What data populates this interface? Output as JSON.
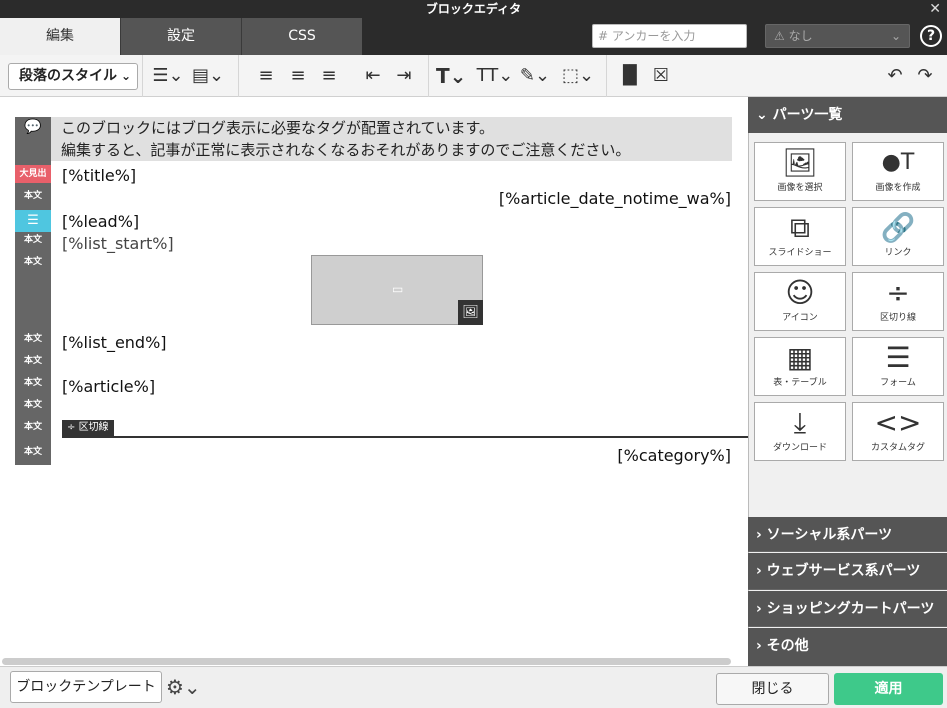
{
  "window": {
    "title": "ブロックエディタ"
  },
  "tabs": [
    {
      "label": "編集"
    },
    {
      "label": "設定"
    },
    {
      "label": "CSS"
    }
  ],
  "anchor": {
    "placeholder": "アンカーを入力",
    "hash": "#"
  },
  "class_select": {
    "value": "なし"
  },
  "toolbar": {
    "paragraph_style": "段落のスタイル"
  },
  "notice": {
    "line1": "このブロックにはブログ表示に必要なタグが配置されています。",
    "line2": "編集すると、記事が正常に表示されなくなるおそれがありますのでご注意ください。"
  },
  "gutter": {
    "heading": "大見出",
    "body": "本文"
  },
  "content": {
    "title": "[%title%]",
    "date": "[%article_date_notime_wa%]",
    "lead": "[%lead%]",
    "list_start": "[%list_start%]",
    "list_end": "[%list_end%]",
    "article": "[%article%]",
    "divider_label": "区切線",
    "category": "[%category%]"
  },
  "parts_panel": {
    "title": "パーツ一覧",
    "items": [
      {
        "label": "画像を選択",
        "icon": "image-select-icon"
      },
      {
        "label": "画像を作成",
        "icon": "image-create-icon"
      },
      {
        "label": "スライドショー",
        "icon": "slideshow-icon"
      },
      {
        "label": "リンク",
        "icon": "link-icon"
      },
      {
        "label": "アイコン",
        "icon": "smiley-icon"
      },
      {
        "label": "区切り線",
        "icon": "divider-icon"
      },
      {
        "label": "表・テーブル",
        "icon": "table-icon"
      },
      {
        "label": "フォーム",
        "icon": "form-icon"
      },
      {
        "label": "ダウンロード",
        "icon": "download-icon"
      },
      {
        "label": "カスタムタグ",
        "icon": "custom-tag-icon"
      }
    ],
    "sections": [
      {
        "label": "ソーシャル系パーツ"
      },
      {
        "label": "ウェブサービス系パーツ"
      },
      {
        "label": "ショッピングカートパーツ"
      },
      {
        "label": "その他"
      }
    ]
  },
  "footer": {
    "template_button": "ブロックテンプレート",
    "close_button": "閉じる",
    "apply_button": "適用"
  },
  "colors": {
    "apply": "#3ec98a",
    "heading_badge": "#e8606a",
    "list_badge": "#4fc6e0"
  }
}
